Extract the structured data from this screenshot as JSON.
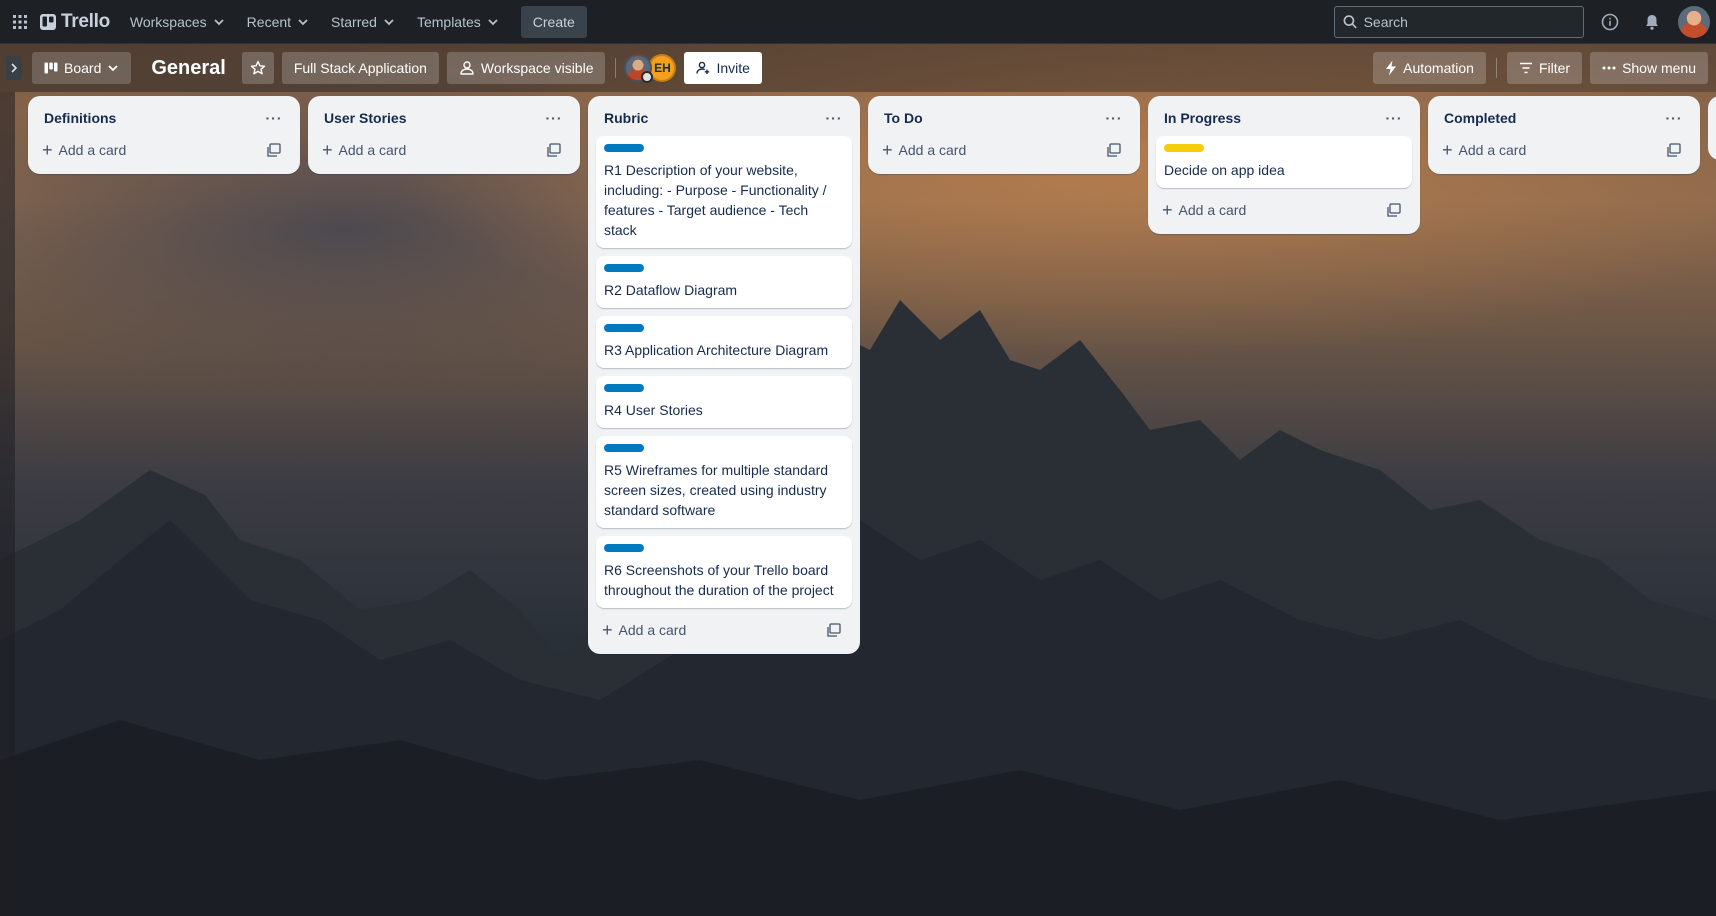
{
  "app": {
    "name": "Trello",
    "nav": {
      "workspaces": "Workspaces",
      "recent": "Recent",
      "starred": "Starred",
      "templates": "Templates",
      "create": "Create",
      "search_placeholder": "Search"
    }
  },
  "board": {
    "view_label": "Board",
    "title": "General",
    "workspace": "Full Stack Application",
    "visibility": "Workspace visible",
    "members": [
      {
        "initials": ""
      },
      {
        "initials": "EH"
      }
    ],
    "invite_label": "Invite",
    "automation_label": "Automation",
    "filter_label": "Filter",
    "show_menu_label": "Show menu"
  },
  "lists": [
    {
      "title": "Definitions",
      "cards": [],
      "add_label": "Add a card"
    },
    {
      "title": "User Stories",
      "cards": [],
      "add_label": "Add a card"
    },
    {
      "title": "Rubric",
      "add_label": "Add a card",
      "cards": [
        {
          "label_color": "#0079bf",
          "title": "R1 Description of your website, including: - Purpose - Functionality / features - Target audience - Tech stack"
        },
        {
          "label_color": "#0079bf",
          "title": "R2 Dataflow Diagram"
        },
        {
          "label_color": "#0079bf",
          "title": "R3 Application Architecture Diagram"
        },
        {
          "label_color": "#0079bf",
          "title": "R4 User Stories"
        },
        {
          "label_color": "#0079bf",
          "title": "R5 Wireframes for multiple standard screen sizes, created using industry standard software"
        },
        {
          "label_color": "#0079bf",
          "title": "R6 Screenshots of your Trello board throughout the duration of the project"
        }
      ]
    },
    {
      "title": "To Do",
      "cards": [],
      "add_label": "Add a card"
    },
    {
      "title": "In Progress",
      "add_label": "Add a card",
      "cards": [
        {
          "label_color": "#f5cd0a",
          "title": "Decide on app idea"
        }
      ]
    },
    {
      "title": "Completed",
      "cards": [],
      "add_label": "Add a card"
    }
  ],
  "icons": {
    "apps": "grid-icon",
    "logo": "trello-logo-icon",
    "chevron": "chevron-down-icon",
    "search": "search-icon",
    "info": "info-icon",
    "notifications": "bell-icon",
    "board_view": "board-icon",
    "star": "star-icon",
    "visibility": "people-icon",
    "invite": "add-person-icon",
    "automation": "lightning-icon",
    "filter": "filter-icon",
    "more": "ellipsis-icon",
    "template": "template-icon"
  }
}
